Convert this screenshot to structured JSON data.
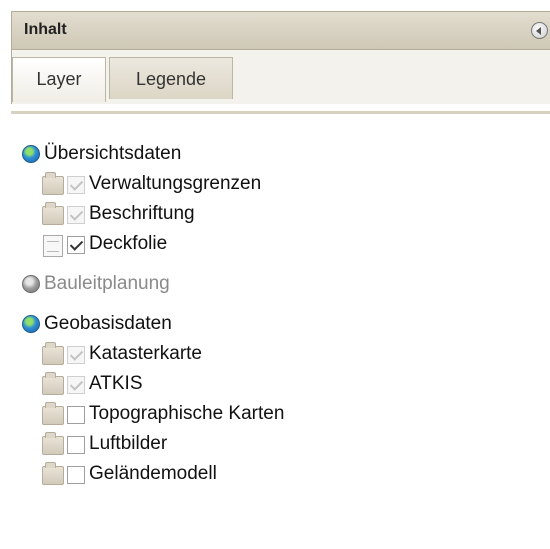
{
  "header": {
    "title": "Inhalt",
    "collapse_icon": "collapse-arrow-icon"
  },
  "tabs": [
    {
      "label": "Layer",
      "active": true
    },
    {
      "label": "Legende",
      "active": false
    }
  ],
  "tree": {
    "groups": [
      {
        "label": "Übersichtsdaten",
        "icon": "globe-icon",
        "enabled": true,
        "items": [
          {
            "label": "Verwaltungsgrenzen",
            "icon": "folder-icon",
            "checked": true,
            "checkbox_disabled": true
          },
          {
            "label": "Beschriftung",
            "icon": "folder-icon",
            "checked": true,
            "checkbox_disabled": true
          },
          {
            "label": "Deckfolie",
            "icon": "document-icon",
            "checked": true,
            "checkbox_disabled": false
          }
        ]
      },
      {
        "label": "Bauleitplanung",
        "icon": "globe-gray-icon",
        "enabled": false,
        "items": []
      },
      {
        "label": "Geobasisdaten",
        "icon": "globe-icon",
        "enabled": true,
        "items": [
          {
            "label": "Katasterkarte",
            "icon": "folder-icon",
            "checked": true,
            "checkbox_disabled": true
          },
          {
            "label": "ATKIS",
            "icon": "folder-icon",
            "checked": true,
            "checkbox_disabled": true
          },
          {
            "label": "Topographische Karten",
            "icon": "folder-icon",
            "checked": false,
            "checkbox_disabled": false
          },
          {
            "label": "Luftbilder",
            "icon": "folder-icon",
            "checked": false,
            "checkbox_disabled": false
          },
          {
            "label": "Geländemodell",
            "icon": "folder-icon",
            "checked": false,
            "checkbox_disabled": false
          }
        ]
      }
    ]
  }
}
